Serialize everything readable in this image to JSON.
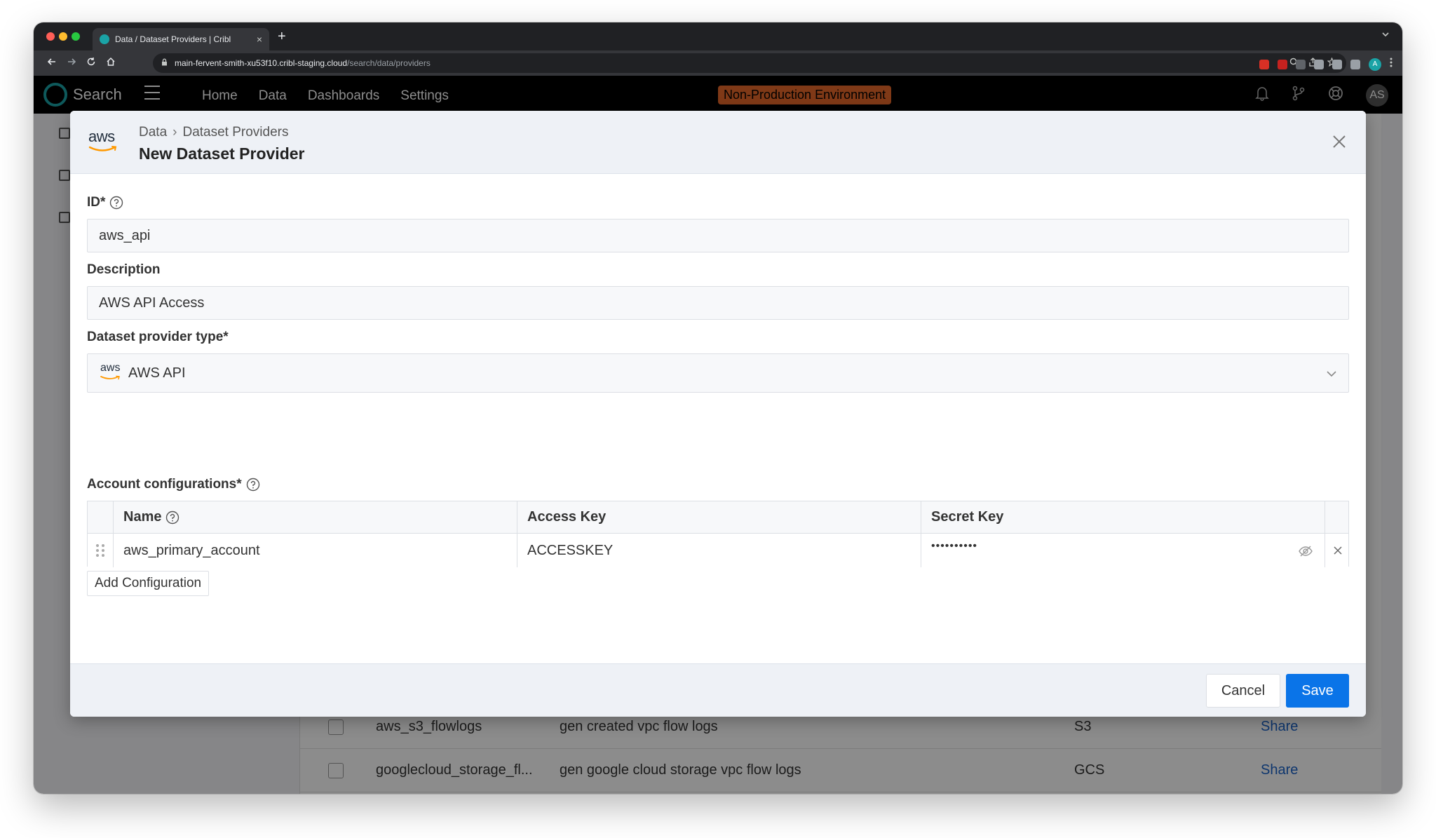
{
  "browser": {
    "tab_title": "Data / Dataset Providers | Cribl",
    "tab_close": "×",
    "new_tab": "+",
    "url_host": "main-fervent-smith-xu53f10.cribl-staging.cloud",
    "url_path": "/search/data/providers",
    "profile_initial": "A"
  },
  "app": {
    "logo_text": "Search",
    "nav": [
      "Home",
      "Data",
      "Dashboards",
      "Settings"
    ],
    "env_badge": "Non-Production Environment",
    "avatar": "AS"
  },
  "background_table": {
    "rows": [
      {
        "name": "aws_s3_flowlogs",
        "description": "gen created vpc flow logs",
        "type": "S3",
        "action": "Share"
      },
      {
        "name": "googlecloud_storage_fl...",
        "description": "gen google cloud storage vpc flow logs",
        "type": "GCS",
        "action": "Share"
      }
    ]
  },
  "modal": {
    "logo_word": "aws",
    "breadcrumb": {
      "root": "Data",
      "separator": "›",
      "current": "Dataset Providers"
    },
    "title": "New Dataset Provider",
    "fields": {
      "id": {
        "label": "ID*",
        "value": "aws_api"
      },
      "description": {
        "label": "Description",
        "value": "AWS API Access"
      },
      "provider_type": {
        "label": "Dataset provider type*",
        "logo_word": "aws",
        "value": "AWS API"
      }
    },
    "accounts": {
      "label": "Account configurations*",
      "columns": [
        "Name",
        "Access Key",
        "Secret Key"
      ],
      "rows": [
        {
          "name": "aws_primary_account",
          "access_key": "ACCESSKEY",
          "secret_key": "••••••••••"
        }
      ],
      "add_label": "Add Configuration"
    },
    "footer": {
      "cancel": "Cancel",
      "save": "Save"
    }
  },
  "colors": {
    "accent_teal": "#1aa3a6",
    "env_badge": "#e8682a",
    "primary_button": "#0a74e8",
    "link_blue": "#1a63c9"
  }
}
